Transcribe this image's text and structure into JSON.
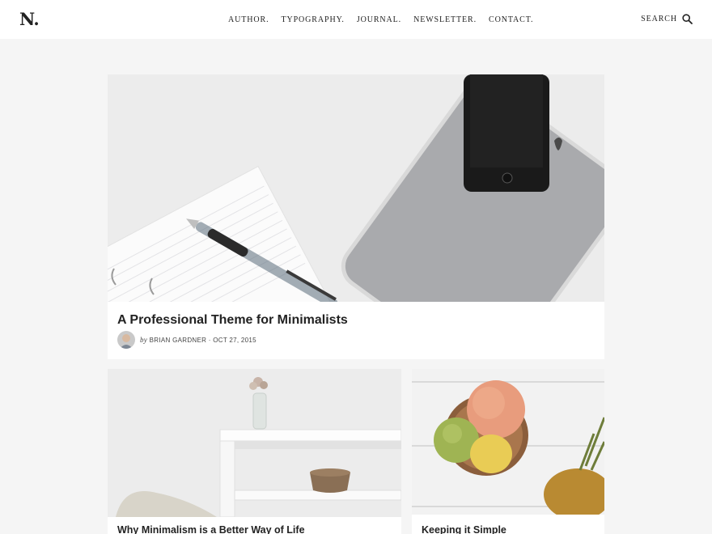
{
  "header": {
    "logo": "N.",
    "nav": [
      "AUTHOR.",
      "TYPOGRAPHY.",
      "JOURNAL.",
      "NEWSLETTER.",
      "CONTACT."
    ],
    "search_label": "SEARCH"
  },
  "featured": {
    "title": "A Professional Theme for Minimalists",
    "by": "by",
    "author_date": "BRIAN GARDNER · OCT 27, 2015"
  },
  "posts": [
    {
      "title": "Why Minimalism is a Better Way of Life"
    },
    {
      "title": "Keeping it Simple"
    }
  ],
  "colors": {
    "background": "#f5f5f5",
    "card": "#ffffff",
    "text": "#222222"
  }
}
